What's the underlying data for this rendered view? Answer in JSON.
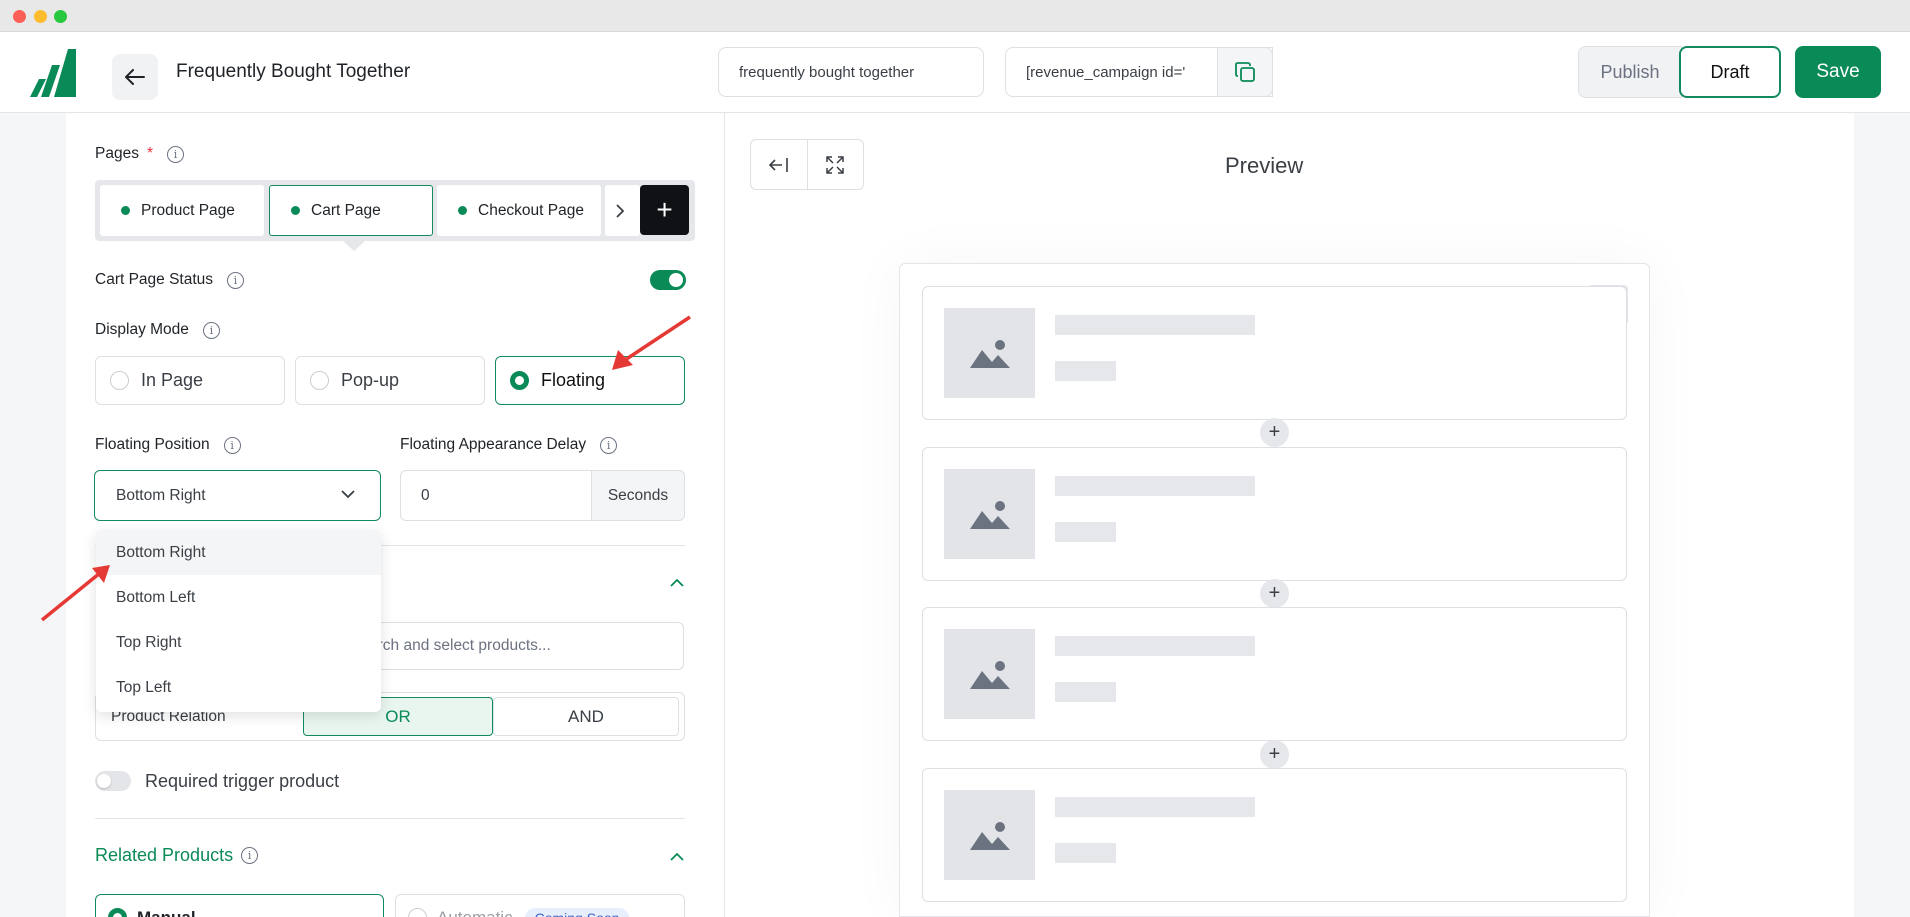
{
  "header": {
    "title": "Frequently Bought Together",
    "campaign_name": "frequently bought together",
    "shortcode": "[revenue_campaign id='",
    "publish_label": "Publish",
    "draft_label": "Draft",
    "save_label": "Save"
  },
  "pages": {
    "label": "Pages",
    "required_mark": "*",
    "tabs": [
      {
        "label": "Product Page"
      },
      {
        "label": "Cart Page"
      },
      {
        "label": "Checkout Page"
      }
    ],
    "add_label": "+"
  },
  "status": {
    "label": "Cart Page Status",
    "enabled": true
  },
  "display_mode": {
    "label": "Display Mode",
    "options": [
      "In Page",
      "Pop-up",
      "Floating"
    ],
    "selected": "Floating"
  },
  "floating": {
    "position_label": "Floating Position",
    "position_value": "Bottom Right",
    "position_options": [
      "Bottom Right",
      "Bottom Left",
      "Top Right",
      "Top Left"
    ],
    "delay_label": "Floating Appearance Delay",
    "delay_value": "0",
    "delay_unit": "Seconds"
  },
  "trigger": {
    "search_placeholder": "arch and select products...",
    "relation_label": "Product Relation",
    "or_label": "OR",
    "and_label": "AND",
    "required_label": "Required trigger product",
    "required_enabled": false
  },
  "related": {
    "title": "Related Products",
    "manual_label": "Manual",
    "automatic_label": "Automatic",
    "coming_soon": "Coming Soon"
  },
  "preview": {
    "title": "Preview"
  },
  "colors": {
    "brand_green": "#0a8a57",
    "arrow_red": "#e53935"
  },
  "icons": [
    "back-arrow-icon",
    "copy-icon",
    "info-icon",
    "chevron-down-icon",
    "chevron-up-icon",
    "chevron-right-icon",
    "plus-icon",
    "collapse-left-icon",
    "expand-icon",
    "close-icon",
    "image-placeholder-icon"
  ]
}
